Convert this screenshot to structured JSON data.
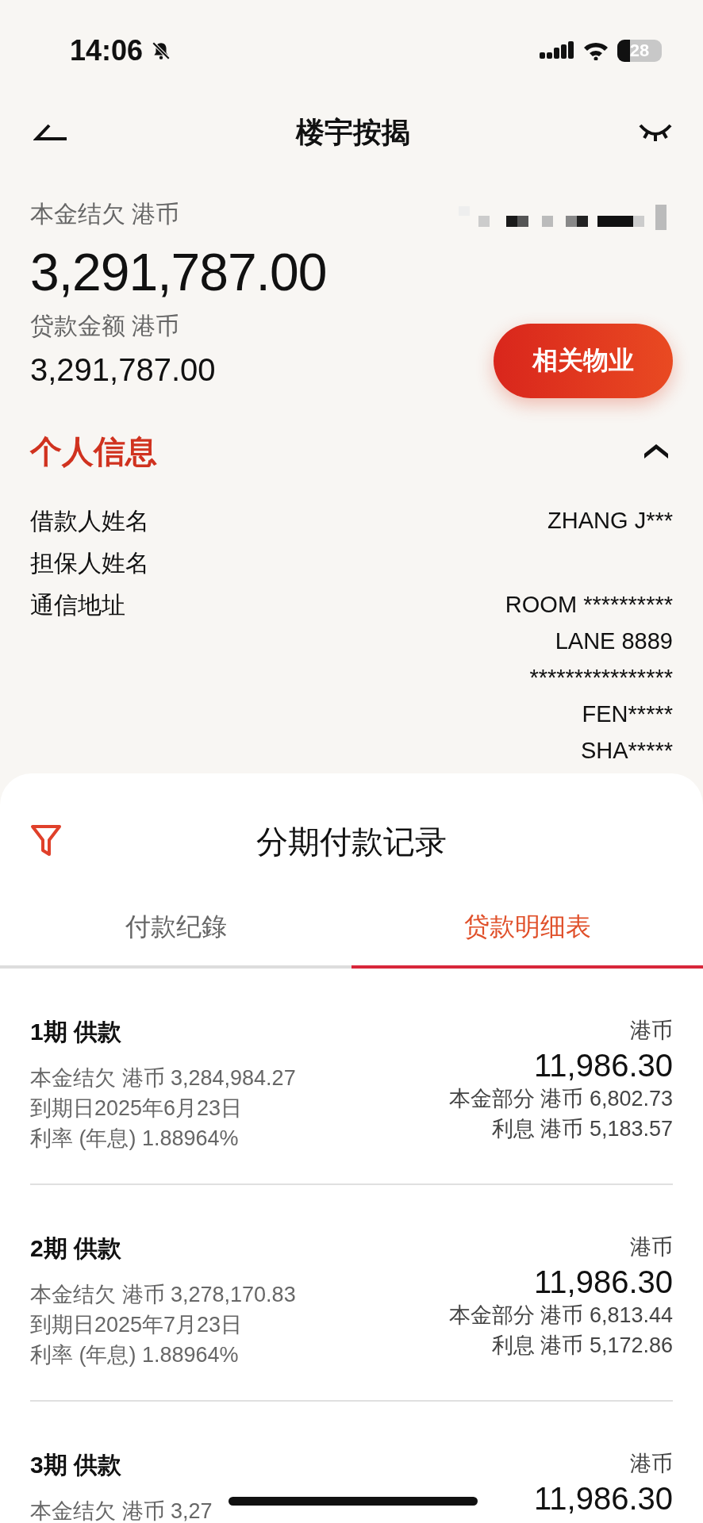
{
  "status_bar": {
    "time": "14:06",
    "battery": "28"
  },
  "nav": {
    "title": "楼宇按揭"
  },
  "summary": {
    "balance_label": "本金结欠 港币",
    "balance": "3,291,787.00",
    "loan_label": "贷款金额 港币",
    "loan": "3,291,787.00",
    "property_button": "相关物业"
  },
  "personal_info": {
    "title": "个人信息",
    "expanded": true,
    "fields": [
      {
        "label": "借款人姓名",
        "lines": [
          "ZHANG J***"
        ]
      },
      {
        "label": "担保人姓名"
      },
      {
        "label": "通信地址",
        "lines": [
          "ROOM **********",
          "LANE 8889",
          "****************",
          "FEN*****",
          "SHA*****"
        ]
      }
    ]
  },
  "sheet": {
    "title": "分期付款记录",
    "tabs": [
      {
        "label": "付款纪錄",
        "selected": false
      },
      {
        "label": "贷款明细表",
        "selected": true
      }
    ],
    "installments": [
      {
        "title": "1期 供款",
        "balance": "本金结欠 港币 3,284,984.27",
        "due": "到期日2025年6月23日",
        "rate": "利率 (年息) 1.88964%",
        "currency": "港币",
        "amount": "11,986.30",
        "principal": "本金部分 港币 6,802.73",
        "interest": "利息 港币 5,183.57"
      },
      {
        "title": "2期 供款",
        "balance": "本金结欠 港币 3,278,170.83",
        "due": "到期日2025年7月23日",
        "rate": "利率 (年息) 1.88964%",
        "currency": "港币",
        "amount": "11,986.30",
        "principal": "本金部分 港币 6,813.44",
        "interest": "利息 港币 5,172.86"
      },
      {
        "title": "3期 供款",
        "balance": "本金结欠 港币 3,27",
        "currency": "港币",
        "amount": "11,986.30"
      }
    ]
  }
}
